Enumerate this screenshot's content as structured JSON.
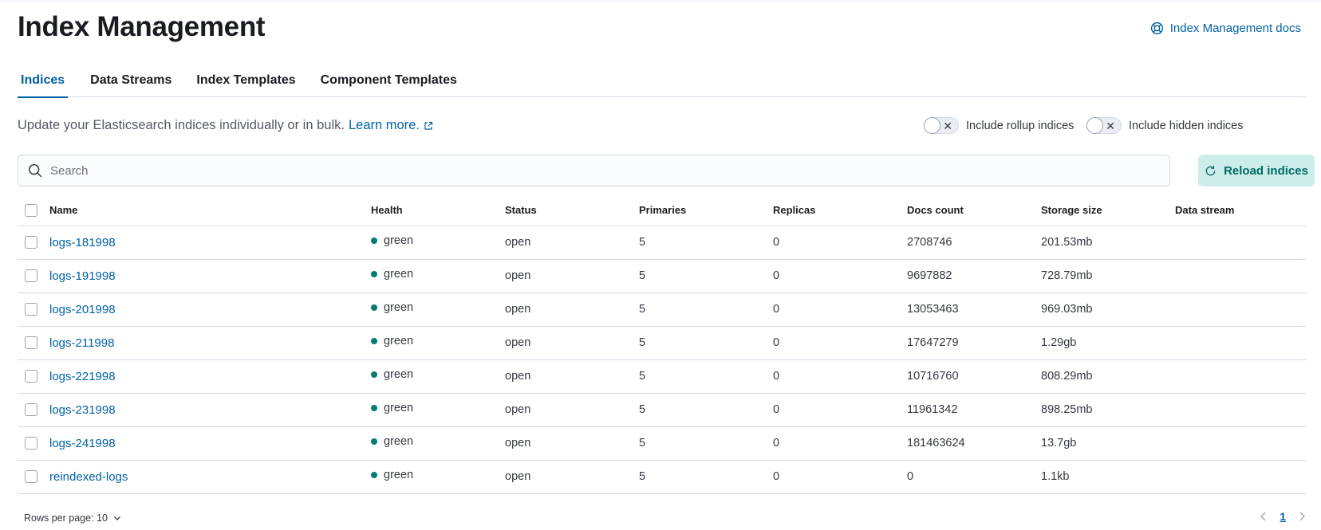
{
  "header": {
    "title": "Index Management",
    "docs_link": "Index Management docs"
  },
  "tabs": [
    {
      "label": "Indices",
      "active": true
    },
    {
      "label": "Data Streams",
      "active": false
    },
    {
      "label": "Index Templates",
      "active": false
    },
    {
      "label": "Component Templates",
      "active": false
    }
  ],
  "description": {
    "text": "Update your Elasticsearch indices individually or in bulk.",
    "link": "Learn more."
  },
  "toggles": {
    "rollup": {
      "label": "Include rollup indices",
      "on": false
    },
    "hidden": {
      "label": "Include hidden indices",
      "on": false
    }
  },
  "search": {
    "placeholder": "Search",
    "value": ""
  },
  "reload_button": "Reload indices",
  "table": {
    "columns": [
      "Name",
      "Health",
      "Status",
      "Primaries",
      "Replicas",
      "Docs count",
      "Storage size",
      "Data stream"
    ],
    "rows": [
      {
        "name": "logs-181998",
        "health": "green",
        "status": "open",
        "primaries": "5",
        "replicas": "0",
        "docs": "2708746",
        "size": "201.53mb",
        "stream": ""
      },
      {
        "name": "logs-191998",
        "health": "green",
        "status": "open",
        "primaries": "5",
        "replicas": "0",
        "docs": "9697882",
        "size": "728.79mb",
        "stream": ""
      },
      {
        "name": "logs-201998",
        "health": "green",
        "status": "open",
        "primaries": "5",
        "replicas": "0",
        "docs": "13053463",
        "size": "969.03mb",
        "stream": ""
      },
      {
        "name": "logs-211998",
        "health": "green",
        "status": "open",
        "primaries": "5",
        "replicas": "0",
        "docs": "17647279",
        "size": "1.29gb",
        "stream": ""
      },
      {
        "name": "logs-221998",
        "health": "green",
        "status": "open",
        "primaries": "5",
        "replicas": "0",
        "docs": "10716760",
        "size": "808.29mb",
        "stream": ""
      },
      {
        "name": "logs-231998",
        "health": "green",
        "status": "open",
        "primaries": "5",
        "replicas": "0",
        "docs": "11961342",
        "size": "898.25mb",
        "stream": ""
      },
      {
        "name": "logs-241998",
        "health": "green",
        "status": "open",
        "primaries": "5",
        "replicas": "0",
        "docs": "181463624",
        "size": "13.7gb",
        "stream": ""
      },
      {
        "name": "reindexed-logs",
        "health": "green",
        "status": "open",
        "primaries": "5",
        "replicas": "0",
        "docs": "0",
        "size": "1.1kb",
        "stream": ""
      }
    ]
  },
  "footer": {
    "rows_per_page": "Rows per page: 10",
    "current_page": "1"
  },
  "colors": {
    "link": "#0061a6",
    "health_green": "#017d73",
    "reload_bg": "#ccede9",
    "reload_text": "#006b63"
  }
}
